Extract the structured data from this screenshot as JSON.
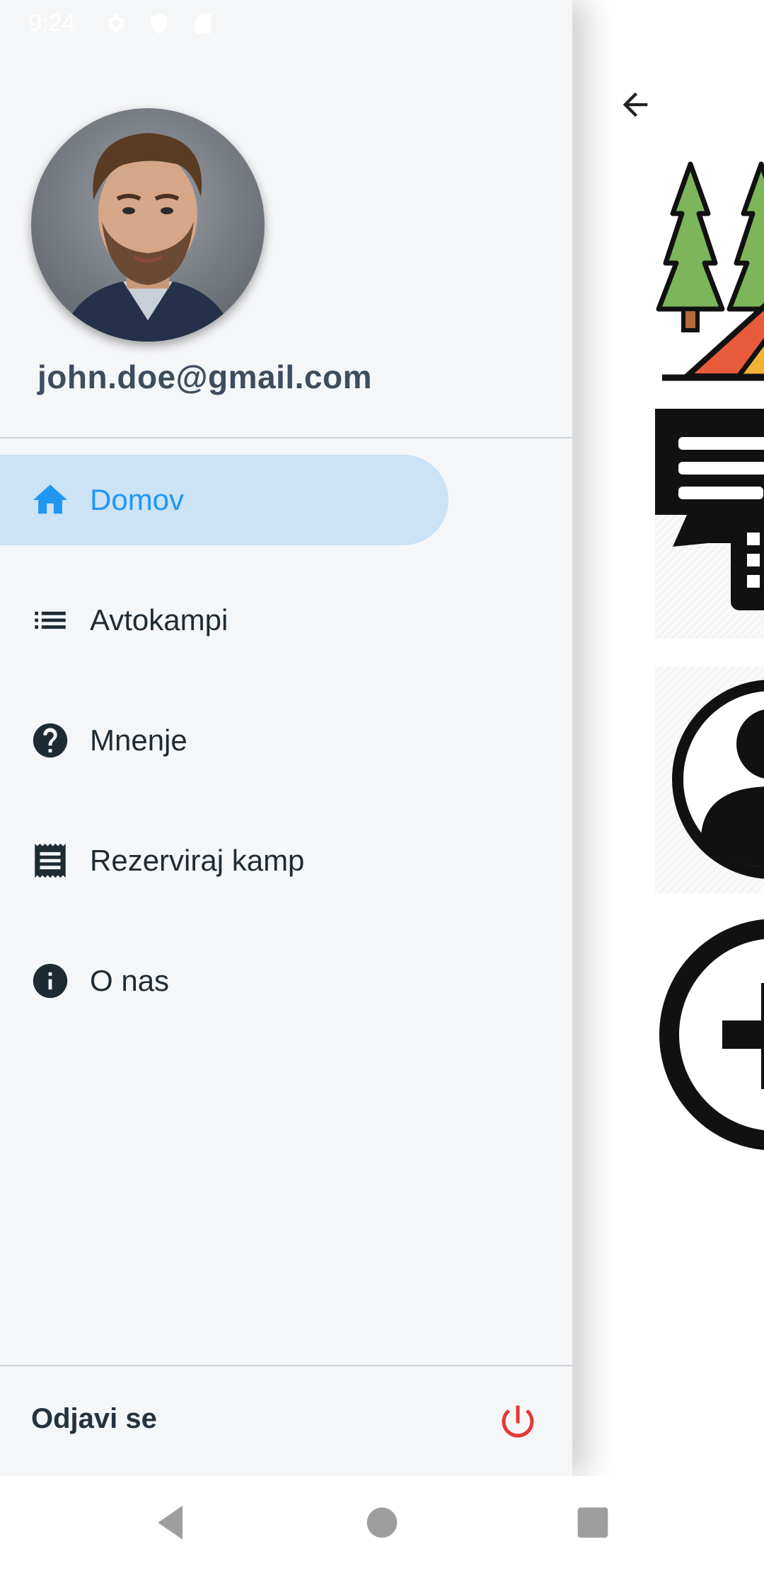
{
  "status_bar": {
    "time": "9:24",
    "icons": [
      "settings-icon",
      "shield-icon",
      "sd-card-icon"
    ]
  },
  "drawer": {
    "email": "john.doe@gmail.com",
    "items": [
      {
        "label": "Domov",
        "icon": "home-icon",
        "active": true
      },
      {
        "label": "Avtokampi",
        "icon": "list-icon",
        "active": false
      },
      {
        "label": "Mnenje",
        "icon": "help-circle-icon",
        "active": false
      },
      {
        "label": "Rezerviraj kamp",
        "icon": "receipt-icon",
        "active": false
      },
      {
        "label": "O nas",
        "icon": "info-icon",
        "active": false
      }
    ],
    "logout_label": "Odjavi se",
    "logout_icon": "power-icon",
    "accent_color": "#2196f3",
    "logout_color": "#e53935"
  },
  "content": {
    "back_icon": "arrow-left-icon",
    "tiles": [
      "camping-tent-icon",
      "chat-icon",
      "user-circle-icon",
      "add-circle-icon"
    ]
  },
  "system_nav": {
    "buttons": [
      "back-triangle-icon",
      "home-circle-icon",
      "recents-square-icon"
    ]
  }
}
